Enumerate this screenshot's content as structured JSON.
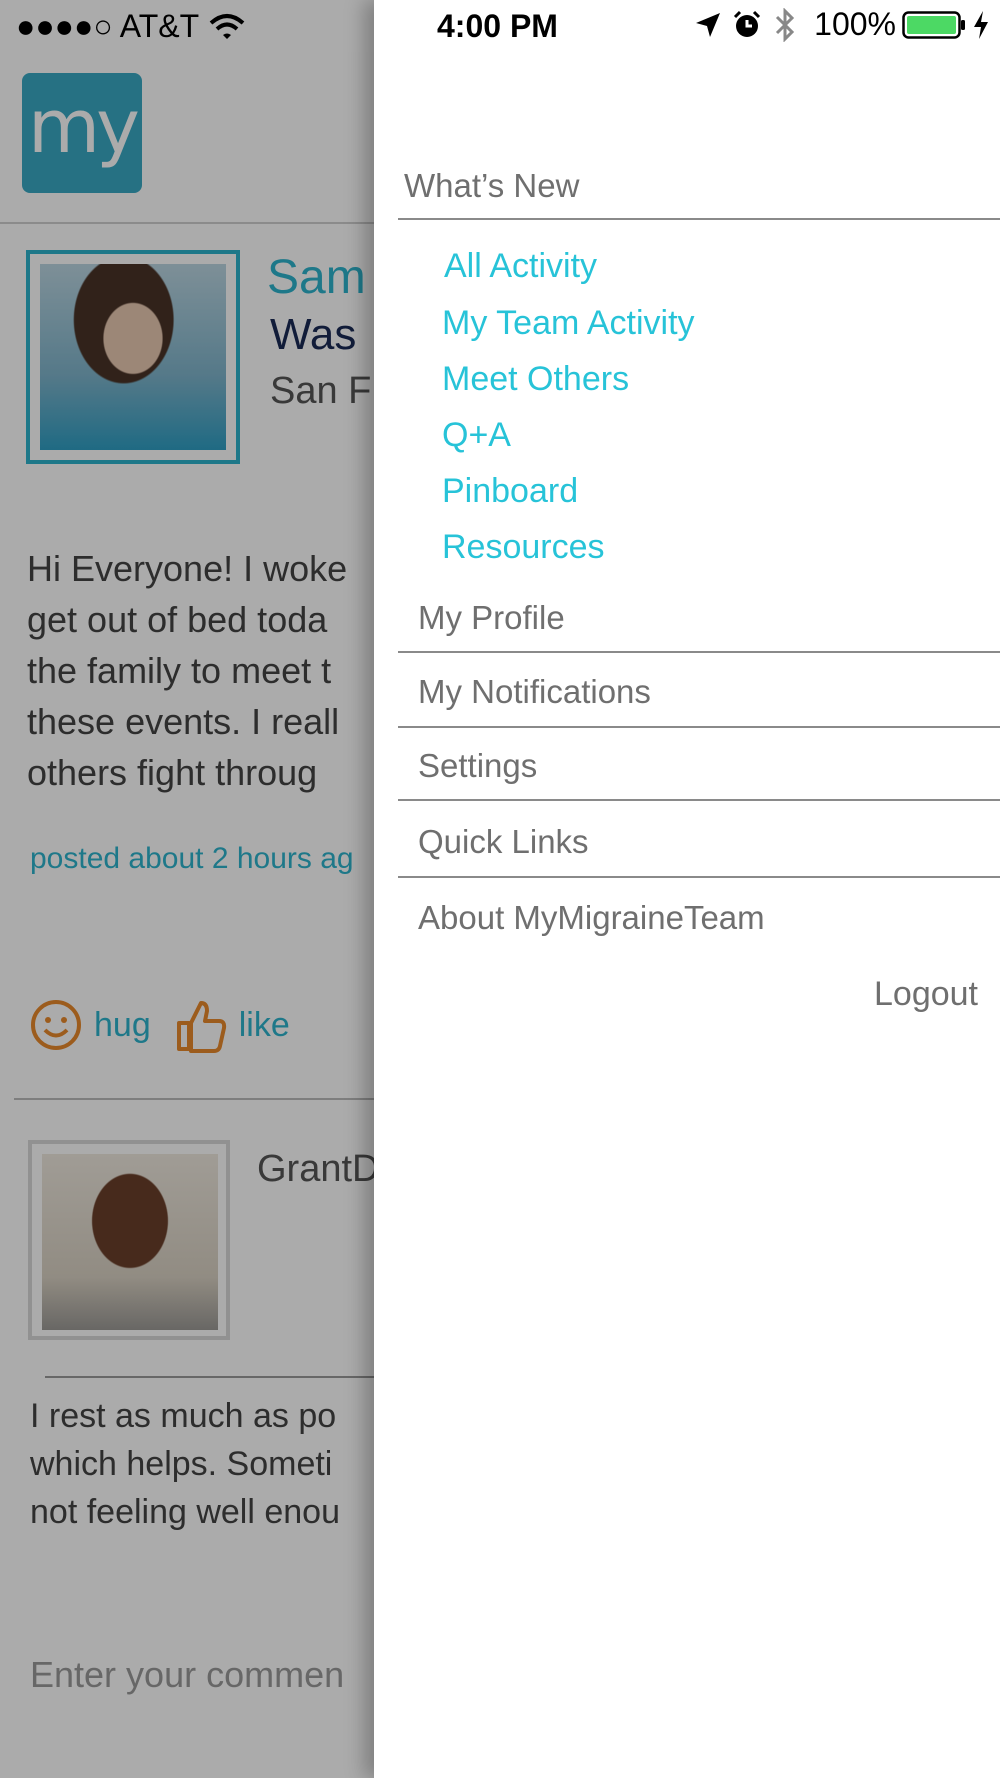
{
  "status_bar": {
    "carrier": "●●●●○ AT&T",
    "time": "4:00 PM",
    "battery": "100%"
  },
  "app": {
    "logo_text": "my",
    "post1": {
      "name": "Sam",
      "line2": "Was",
      "location": "San F",
      "body": "Hi Everyone! I woke get out of bed toda the family to meet t these events. I reall others fight throug",
      "time": "posted about 2 hours ag"
    },
    "reactions": {
      "hug_label": "hug",
      "like_label": "like"
    },
    "post2": {
      "name": "GrantD",
      "body": "I rest as much as po which helps. Someti not feeling well enou"
    },
    "comment_placeholder": "Enter your commen"
  },
  "drawer": {
    "whats_new": "What’s New",
    "sub_items": [
      "All Activity",
      "My Team Activity",
      "Meet Others",
      "Q+A",
      "Pinboard",
      "Resources"
    ],
    "my_profile": "My Profile",
    "my_notifications": "My Notifications",
    "settings": "Settings",
    "quick_links": "Quick Links",
    "about": "About MyMigraineTeam",
    "logout": "Logout"
  },
  "colors": {
    "accent": "#27c3d8",
    "menu_text": "#6f6f6f",
    "battery_green": "#4cd964",
    "logo_bg": "#3aa9c4",
    "reaction_orange": "#e98a2c"
  }
}
